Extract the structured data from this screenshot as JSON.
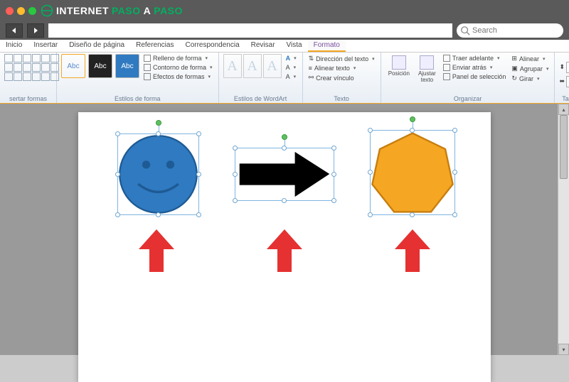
{
  "browser": {
    "logo_text_1": "INTERNET",
    "logo_text_2": "PASO",
    "logo_text_3": "A",
    "logo_text_4": "PASO",
    "search_placeholder": "Search"
  },
  "tabs": {
    "inicio": "Inicio",
    "insertar": "Insertar",
    "diseno": "Diseño de página",
    "referencias": "Referencias",
    "correspondencia": "Correspondencia",
    "revisar": "Revisar",
    "vista": "Vista",
    "formato": "Formato"
  },
  "ribbon": {
    "insertar_formas": "sertar formas",
    "estilos_forma": "Estilos de forma",
    "abc": "Abc",
    "relleno": "Relleno de forma",
    "contorno": "Contorno de forma",
    "efectos": "Efectos de formas",
    "estilos_wordart": "Estilos de WordArt",
    "texto": "Texto",
    "direccion": "Dirección del texto",
    "alinear_texto": "Alinear texto",
    "vinculo": "Crear vínculo",
    "organizar": "Organizar",
    "posicion": "Posición",
    "ajustar": "Ajustar texto",
    "traer": "Traer adelante",
    "enviar": "Enviar atrás",
    "panel": "Panel de selección",
    "alinear": "Alinear",
    "agrupar": "Agrupar",
    "girar": "Girar",
    "tamano": "Tamaño"
  },
  "colors": {
    "smiley": "#2f7ac0",
    "heptagon": "#f5a623",
    "arrow": "#000000",
    "red_arrow": "#e53131"
  }
}
